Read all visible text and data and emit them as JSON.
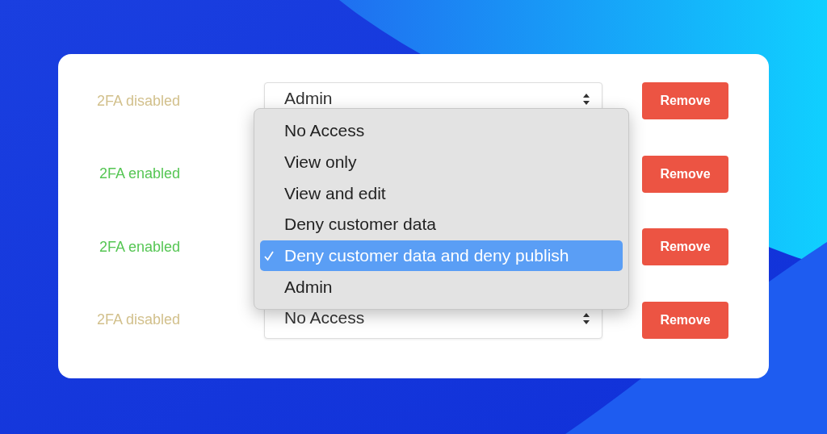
{
  "rows": [
    {
      "status": "2FA disabled",
      "enabled": false,
      "select": {
        "value": "Admin"
      },
      "button": "Remove"
    },
    {
      "status": "2FA enabled",
      "enabled": true,
      "button": "Remove"
    },
    {
      "status": "2FA enabled",
      "enabled": true,
      "button": "Remove"
    },
    {
      "status": "2FA disabled",
      "enabled": false,
      "select": {
        "value": "No Access"
      },
      "button": "Remove"
    }
  ],
  "menu": {
    "items": [
      {
        "label": "No Access",
        "selected": false
      },
      {
        "label": "View only",
        "selected": false
      },
      {
        "label": "View and edit",
        "selected": false
      },
      {
        "label": "Deny customer data",
        "selected": false
      },
      {
        "label": "Deny customer data and deny publish",
        "selected": true
      },
      {
        "label": "Admin",
        "selected": false
      }
    ]
  }
}
